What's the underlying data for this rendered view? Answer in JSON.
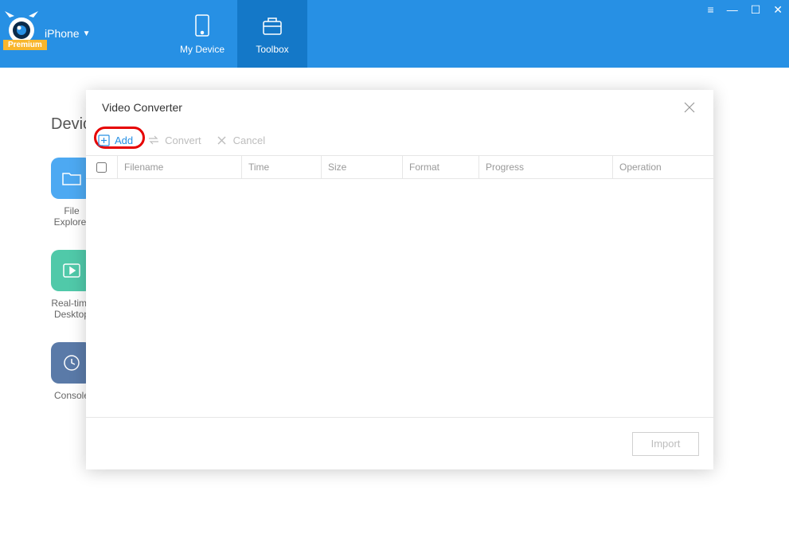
{
  "header": {
    "device_name": "iPhone",
    "premium_label": "Premium",
    "tabs": [
      {
        "label": "My Device"
      },
      {
        "label": "Toolbox"
      }
    ]
  },
  "bg": {
    "section_title": "Device",
    "items": [
      {
        "label_line1": "File",
        "label_line2": "Explorer"
      },
      {
        "label_line1": "Real-time",
        "label_line2": "Desktop"
      },
      {
        "label_line1": "Console",
        "label_line2": ""
      }
    ]
  },
  "modal": {
    "title": "Video Converter",
    "toolbar": {
      "add": "Add",
      "convert": "Convert",
      "cancel": "Cancel"
    },
    "columns": {
      "filename": "Filename",
      "time": "Time",
      "size": "Size",
      "format": "Format",
      "progress": "Progress",
      "operation": "Operation"
    },
    "import_label": "Import"
  }
}
